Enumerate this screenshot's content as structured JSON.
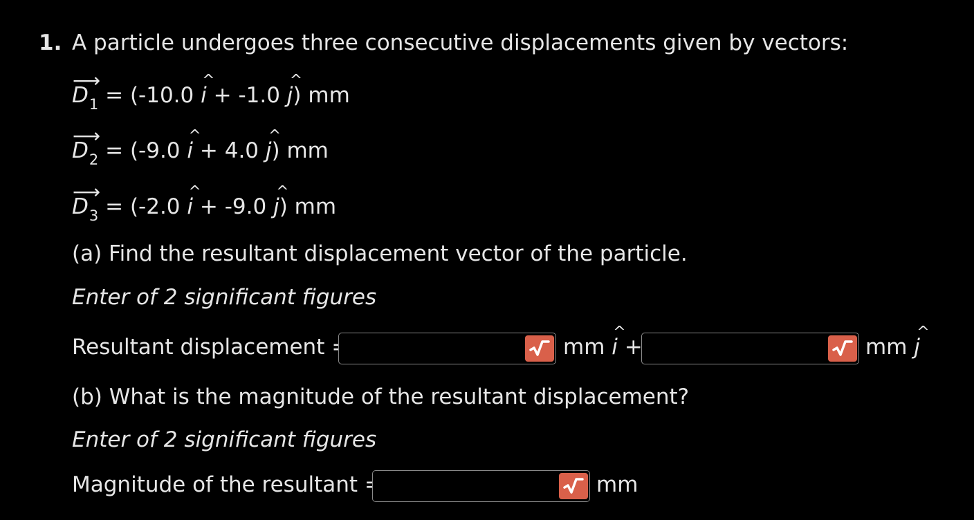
{
  "question": {
    "number": "1.",
    "prompt": "A particle undergoes three consecutive displacements given by vectors:",
    "vectors": [
      {
        "name": "D",
        "sub": "1",
        "eq": "=",
        "open": "(-10.0",
        "plus": "+ -1.0",
        "close": ") mm"
      },
      {
        "name": "D",
        "sub": "2",
        "eq": "=",
        "open": "(-9.0",
        "plus": "+ 4.0",
        "close": ") mm"
      },
      {
        "name": "D",
        "sub": "3",
        "eq": "=",
        "open": "(-2.0",
        "plus": "+ -9.0",
        "close": ") mm"
      }
    ],
    "unit_i": "i",
    "unit_j": "j",
    "hat": "^",
    "arrow": "⟶"
  },
  "part_a": {
    "question": "(a) Find the resultant displacement vector of the particle.",
    "note": "Enter of 2 significant figures",
    "label": "Resultant displacement =",
    "input_i_value": "",
    "input_j_value": "",
    "unit_after_i": "mm",
    "plus": "+",
    "unit_after_j": "mm"
  },
  "part_b": {
    "question": "(b) What is the magnitude of the resultant displacement?",
    "note": "Enter of 2 significant figures",
    "label": "Magnitude of the resultant =",
    "input_value": "",
    "unit": "mm"
  },
  "colors": {
    "background": "#000000",
    "text": "#e6e6e6",
    "sqrt_button": "#d9604a",
    "input_border": "#8a8a8a"
  },
  "icons": {
    "math_editor": "sqrt-icon"
  }
}
